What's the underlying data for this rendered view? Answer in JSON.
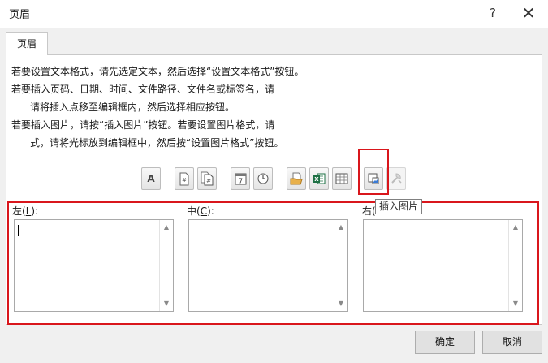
{
  "window": {
    "title": "页眉",
    "help_glyph": "?",
    "close_glyph": "✕"
  },
  "tabs": [
    {
      "label": "页眉",
      "selected": true
    }
  ],
  "instructions": [
    "若要设置文本格式，请先选定文本，然后选择“设置文本格式”按钮。",
    "若要插入页码、日期、时间、文件路径、文件名或标签名，请",
    "请将插入点移至编辑框内，然后选择相应按钮。",
    "若要插入图片，请按“插入图片”按钮。若要设置图片格式，请",
    "式，请将光标放到编辑框中，然后按“设置图片格式”按钮。"
  ],
  "toolbar": {
    "buttons": [
      {
        "id": "format-text",
        "icon": "format-text-icon",
        "glyph": "A"
      },
      {
        "id": "page-number",
        "icon": "page-number-icon",
        "glyph": "#"
      },
      {
        "id": "total-pages",
        "icon": "total-pages-icon",
        "glyph": "#"
      },
      {
        "id": "date",
        "icon": "date-icon",
        "glyph": "7"
      },
      {
        "id": "time",
        "icon": "time-icon"
      },
      {
        "id": "file-path",
        "icon": "file-path-icon"
      },
      {
        "id": "file-name",
        "icon": "file-name-icon",
        "glyph": "X"
      },
      {
        "id": "sheet-name",
        "icon": "sheet-name-icon"
      },
      {
        "id": "insert-picture",
        "icon": "insert-picture-icon"
      },
      {
        "id": "format-picture",
        "icon": "format-picture-icon",
        "disabled": true
      }
    ],
    "tooltip": "插入图片"
  },
  "sections": {
    "left": {
      "label": "左(",
      "accel": "L",
      "label_end": "):",
      "value": ""
    },
    "center": {
      "label": "中(",
      "accel": "C",
      "label_end": "):",
      "value": ""
    },
    "right": {
      "label": "右(",
      "accel": "",
      "label_end": "",
      "value": ""
    }
  },
  "buttons": {
    "ok": "确定",
    "cancel": "取消"
  },
  "colors": {
    "highlight": "#d9161c",
    "dialog_bg": "#f0f0f0",
    "excel_green": "#1d7044"
  }
}
